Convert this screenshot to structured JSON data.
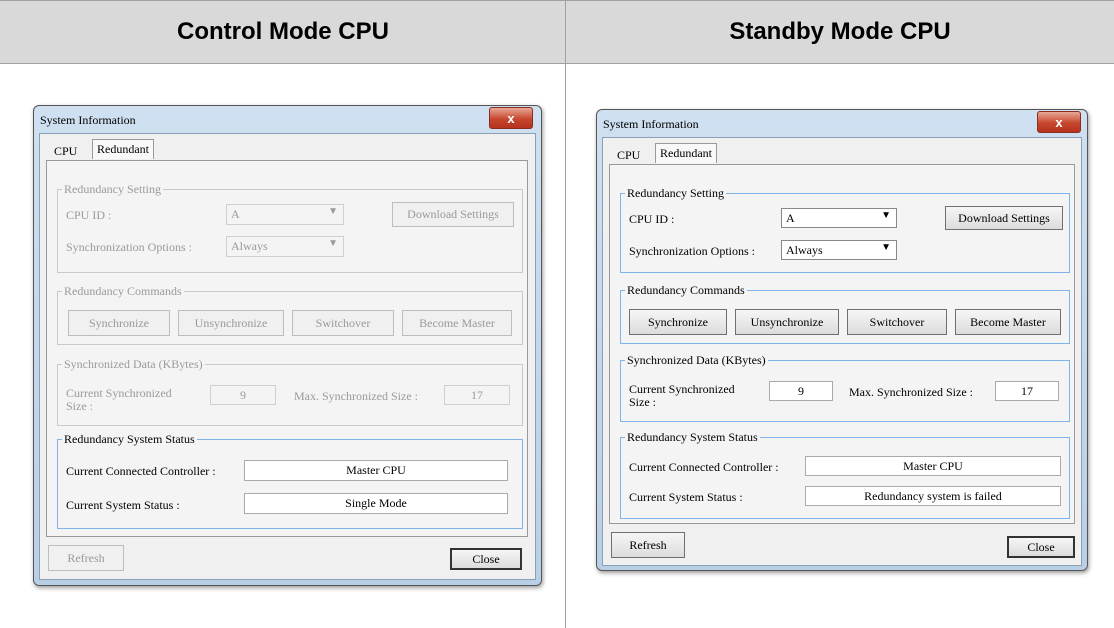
{
  "headers": {
    "left": "Control Mode CPU",
    "right": "Standby Mode CPU"
  },
  "dialogs": {
    "left": {
      "title": "System Information",
      "close_glyph": "x",
      "tabs": [
        "CPU",
        "Redundant"
      ],
      "setting_title": "Redundancy Setting",
      "cpu_id_label": "CPU ID :",
      "cpu_id_value": "A",
      "sync_options_label": "Synchronization Options :",
      "sync_options_value": "Always",
      "download_label": "Download Settings",
      "commands_title": "Redundancy Commands",
      "synchronize_label": "Synchronize",
      "unsynchronize_label": "Unsynchronize",
      "switchover_label": "Switchover",
      "become_master_label": "Become Master",
      "sync_data_title": "Synchronized Data (KBytes)",
      "current_sync_label": "Current Synchronized Size :",
      "current_sync_value": "9",
      "max_sync_label": "Max. Synchronized Size :",
      "max_sync_value": "17",
      "status_title": "Redundancy System Status",
      "connected_label": "Current Connected Controller :",
      "connected_value": "Master CPU",
      "system_status_label": "Current System Status :",
      "system_status_value": "Single Mode",
      "refresh_label": "Refresh",
      "close_label": "Close"
    },
    "right": {
      "title": "System Information",
      "close_glyph": "x",
      "tabs": [
        "CPU",
        "Redundant"
      ],
      "setting_title": "Redundancy Setting",
      "cpu_id_label": "CPU ID :",
      "cpu_id_value": "A",
      "sync_options_label": "Synchronization Options :",
      "sync_options_value": "Always",
      "download_label": "Download Settings",
      "commands_title": "Redundancy Commands",
      "synchronize_label": "Synchronize",
      "unsynchronize_label": "Unsynchronize",
      "switchover_label": "Switchover",
      "become_master_label": "Become Master",
      "sync_data_title": "Synchronized Data (KBytes)",
      "current_sync_label": "Current Synchronized Size :",
      "current_sync_value": "9",
      "max_sync_label": "Max. Synchronized Size :",
      "max_sync_value": "17",
      "status_title": "Redundancy System Status",
      "connected_label": "Current Connected Controller :",
      "connected_value": "Master CPU",
      "system_status_label": "Current System Status :",
      "system_status_value": "Redundancy system is failed",
      "refresh_label": "Refresh",
      "close_label": "Close"
    }
  },
  "colors": {
    "header_bg": "#d9d9d9",
    "group_border_active": "#7eb4ea",
    "close_x_red": "#c7472e"
  }
}
